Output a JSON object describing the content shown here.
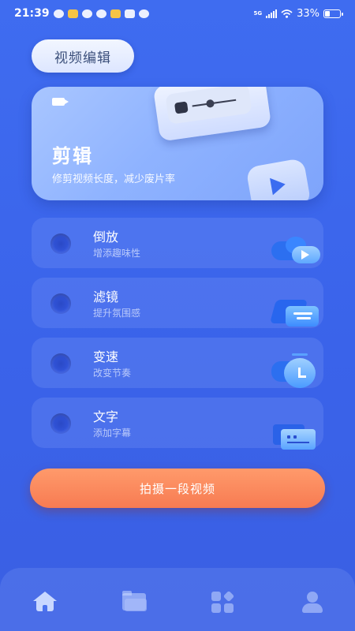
{
  "status_bar": {
    "time": "21:39",
    "network": "5G",
    "battery": "33%",
    "battery_level": 0.33
  },
  "header": {
    "title": "视频编辑"
  },
  "hero": {
    "title": "剪辑",
    "subtitle": "修剪视频长度，减少废片率",
    "icons": [
      "camera-icon",
      "pause-icon",
      "play-icon"
    ]
  },
  "features": [
    {
      "title": "倒放",
      "subtitle": "增添趣味性",
      "icon": "cloud-play-icon"
    },
    {
      "title": "滤镜",
      "subtitle": "提升氛围感",
      "icon": "layers-icon"
    },
    {
      "title": "变速",
      "subtitle": "改变节奏",
      "icon": "clock-icon"
    },
    {
      "title": "文字",
      "subtitle": "添加字幕",
      "icon": "text-box-icon"
    }
  ],
  "record_button": {
    "label": "拍摄一段视频"
  },
  "bottom_nav": {
    "items": [
      "home-icon",
      "folder-icon",
      "apps-icon",
      "user-icon"
    ],
    "active": "home-icon"
  },
  "colors": {
    "background": "#3f6cf0",
    "accent_orange": "#f77b52",
    "card_light": "#a9c6ff"
  }
}
